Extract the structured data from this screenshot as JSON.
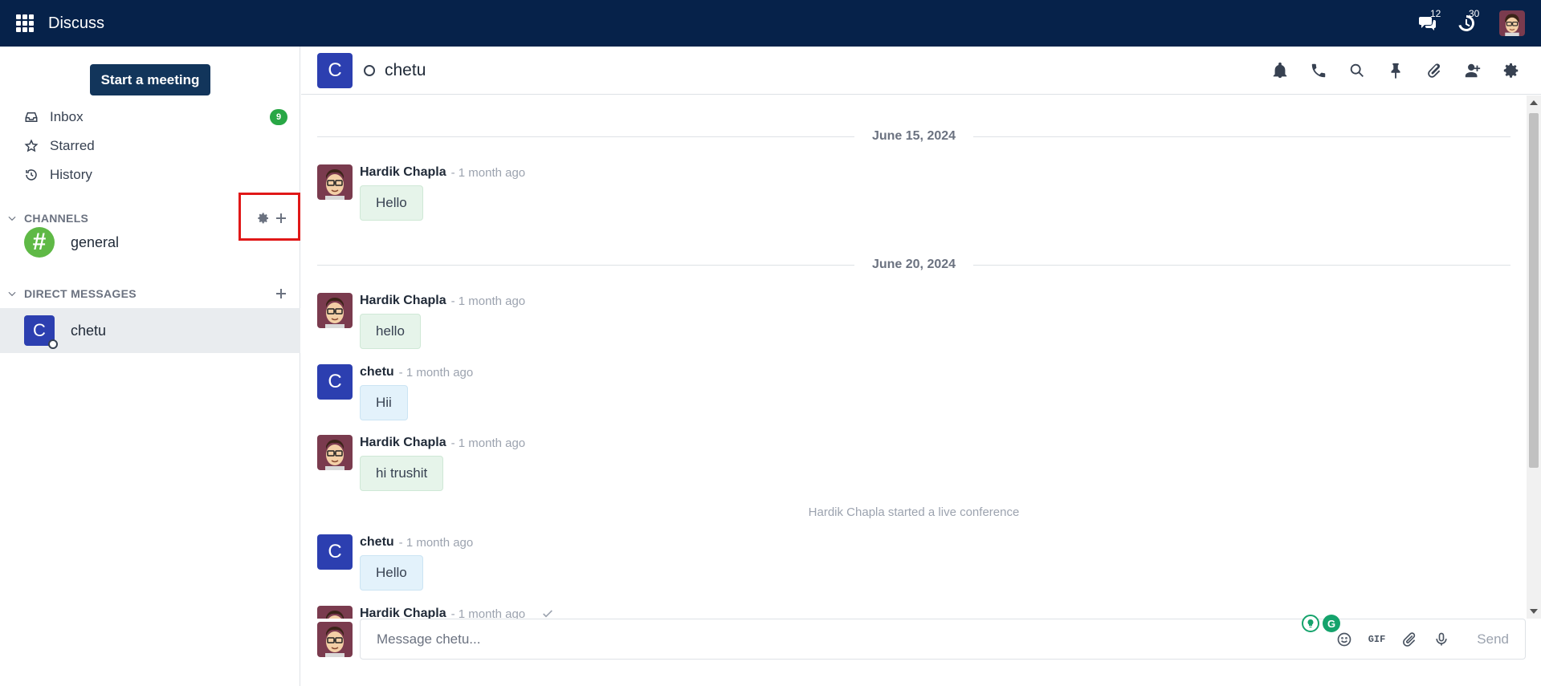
{
  "topbar": {
    "app_title": "Discuss",
    "messages_count": "12",
    "activities_count": "30",
    "icons": [
      "apps-grid-icon",
      "chat-bubbles-icon",
      "activity-clock-icon"
    ]
  },
  "sidebar": {
    "start_meeting_label": "Start a meeting",
    "mailboxes": [
      {
        "label": "Inbox",
        "count": "9",
        "icon": "inbox-icon"
      },
      {
        "label": "Starred",
        "icon": "star-icon"
      },
      {
        "label": "History",
        "icon": "history-icon"
      }
    ],
    "channels_title": "CHANNELS",
    "channels": [
      {
        "label": "general",
        "avatar": "#"
      }
    ],
    "direct_title": "DIRECT MESSAGES",
    "direct_messages": [
      {
        "label": "chetu",
        "avatar": "C"
      }
    ]
  },
  "header": {
    "avatar": "C",
    "name": "chetu",
    "actions": [
      "bell-icon",
      "phone-icon",
      "search-icon",
      "pin-icon",
      "paperclip-icon",
      "add-user-icon",
      "gear-icon"
    ]
  },
  "thread": {
    "dates": [
      "June 15, 2024",
      "June 20, 2024"
    ],
    "messages": [
      {
        "author": "Hardik Chapla",
        "time": "- 1 month ago",
        "text": "Hello"
      },
      {
        "author": "Hardik Chapla",
        "time": "- 1 month ago",
        "text": "hello"
      },
      {
        "author": "chetu",
        "time": "- 1 month ago",
        "text": "Hii",
        "avatar": "C"
      },
      {
        "author": "Hardik Chapla",
        "time": "- 1 month ago",
        "text": "hi trushit"
      },
      {
        "author": "chetu",
        "time": "- 1 month ago",
        "text": "Hello",
        "avatar": "C"
      },
      {
        "author": "Hardik Chapla",
        "time": "- 1 month ago"
      }
    ],
    "notification": "Hardik Chapla started a live conference"
  },
  "composer": {
    "placeholder": "Message chetu...",
    "gif_label": "GIF",
    "send_label": "Send",
    "grammarly_label": "G"
  },
  "colors": {
    "navbar": "#06224a",
    "accent": "#12355b",
    "badge": "#28a745",
    "avatar_blue": "#2c3fb0",
    "channel_green": "#5fb946",
    "highlight": "#e01818"
  }
}
